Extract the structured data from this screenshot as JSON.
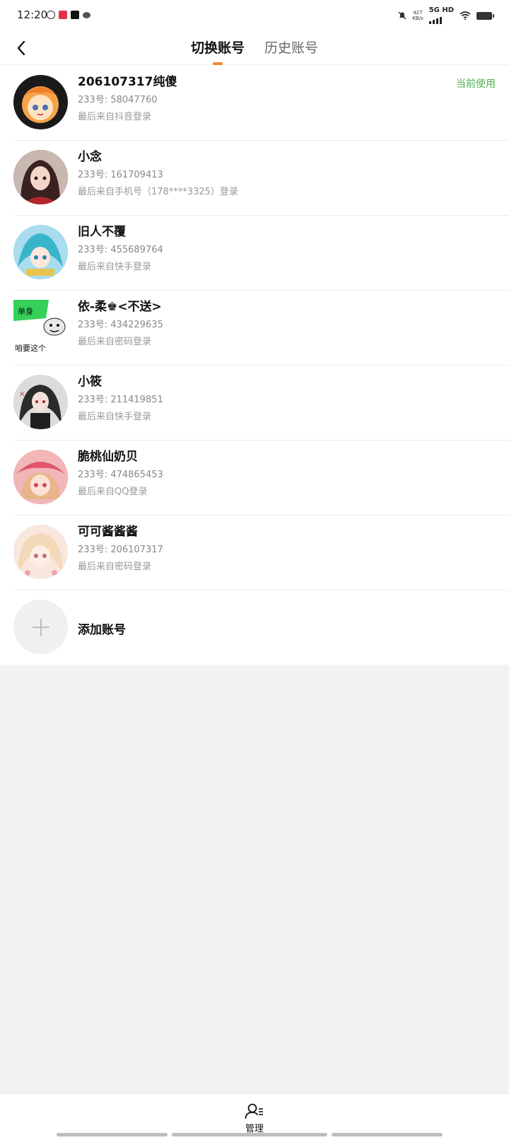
{
  "status": {
    "time": "12:20",
    "speed_value": "427",
    "speed_unit": "KB/s",
    "network": "5G HD"
  },
  "header": {
    "tabs": [
      {
        "label": "切换账号",
        "active": true
      },
      {
        "label": "历史账号",
        "active": false
      }
    ]
  },
  "accounts": [
    {
      "name": "206107317纯傻",
      "id_line": "233号: 58047760",
      "from": "最后来自抖音登录",
      "current": "当前使用"
    },
    {
      "name": "小念",
      "id_line": "233号: 161709413",
      "from": "最后来自手机号（178****3325）登录"
    },
    {
      "name": "旧人不覆",
      "id_line": "233号: 455689764",
      "from": "最后来自快手登录"
    },
    {
      "name": "依-柔♚<不送>",
      "id_line": "233号: 434229635",
      "from": "最后来自密码登录"
    },
    {
      "name": "小筱",
      "id_line": "233号: 211419851",
      "from": "最后来自快手登录"
    },
    {
      "name": "脆桃仙奶贝",
      "id_line": "233号: 474865453",
      "from": "最后来自QQ登录"
    },
    {
      "name": "可可酱酱酱",
      "id_line": "233号: 206107317",
      "from": "最后来自密码登录"
    }
  ],
  "avatar_meme_text": {
    "top": "单身",
    "bottom": "咱要这个"
  },
  "add_account": {
    "label": "添加账号"
  },
  "bottom": {
    "manage_label": "管理"
  },
  "colors": {
    "accent": "#f08a2e",
    "current": "#4caf50"
  }
}
